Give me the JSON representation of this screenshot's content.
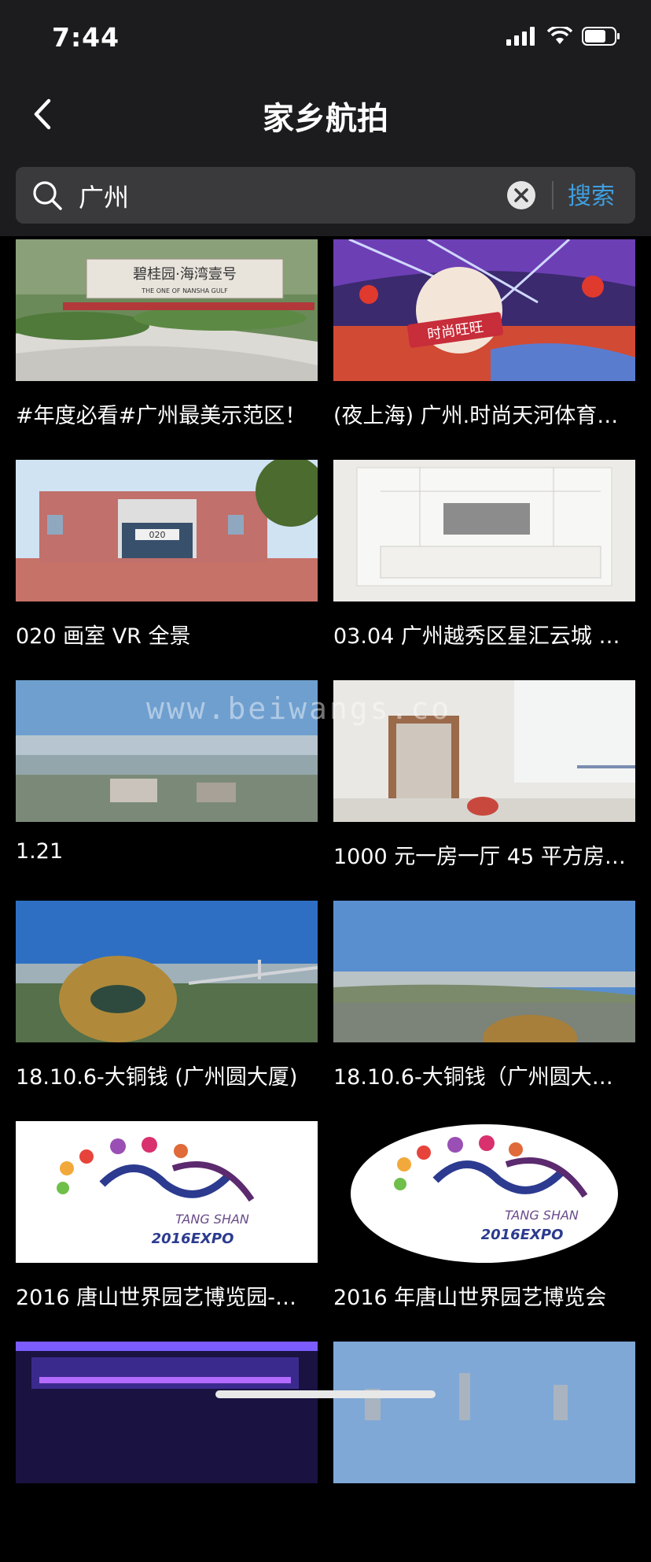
{
  "status_bar": {
    "time": "7:44"
  },
  "nav": {
    "title": "家乡航拍"
  },
  "search": {
    "value": "广州",
    "button_label": "搜索"
  },
  "results": [
    {
      "title": "#年度必看#广州最美示范区！",
      "thumb_text": "碧桂园·海湾壹号",
      "thumb_subtext": "THE ONE OF NANSHA GULF"
    },
    {
      "title": "(夜上海) 广州.时尚天河体育…",
      "thumb_text": "时尚旺旺"
    },
    {
      "title": "020 画室 VR 全景",
      "thumb_text": "020"
    },
    {
      "title": "03.04 广州越秀区星汇云城 …"
    },
    {
      "title": "1.21"
    },
    {
      "title": "1000 元一房一厅 45 平方房…"
    },
    {
      "title": "18.10.6-大铜钱 (广州圆大厦)"
    },
    {
      "title": "18.10.6-大铜钱（广州圆大…"
    },
    {
      "title": "2016 唐山世界园艺博览园-…",
      "thumb_text": "TANG SHAN",
      "thumb_subtext": "2016EXPO"
    },
    {
      "title": "2016 年唐山世界园艺博览会",
      "thumb_text": "TANG SHAN",
      "thumb_subtext": "2016EXPO"
    },
    {
      "title": ""
    },
    {
      "title": ""
    }
  ],
  "watermark": "www.beiwangs.co",
  "colors": {
    "accent": "#3f9fe0",
    "bar_bg": "#1c1c1e",
    "search_bg": "#3a3a3c"
  }
}
